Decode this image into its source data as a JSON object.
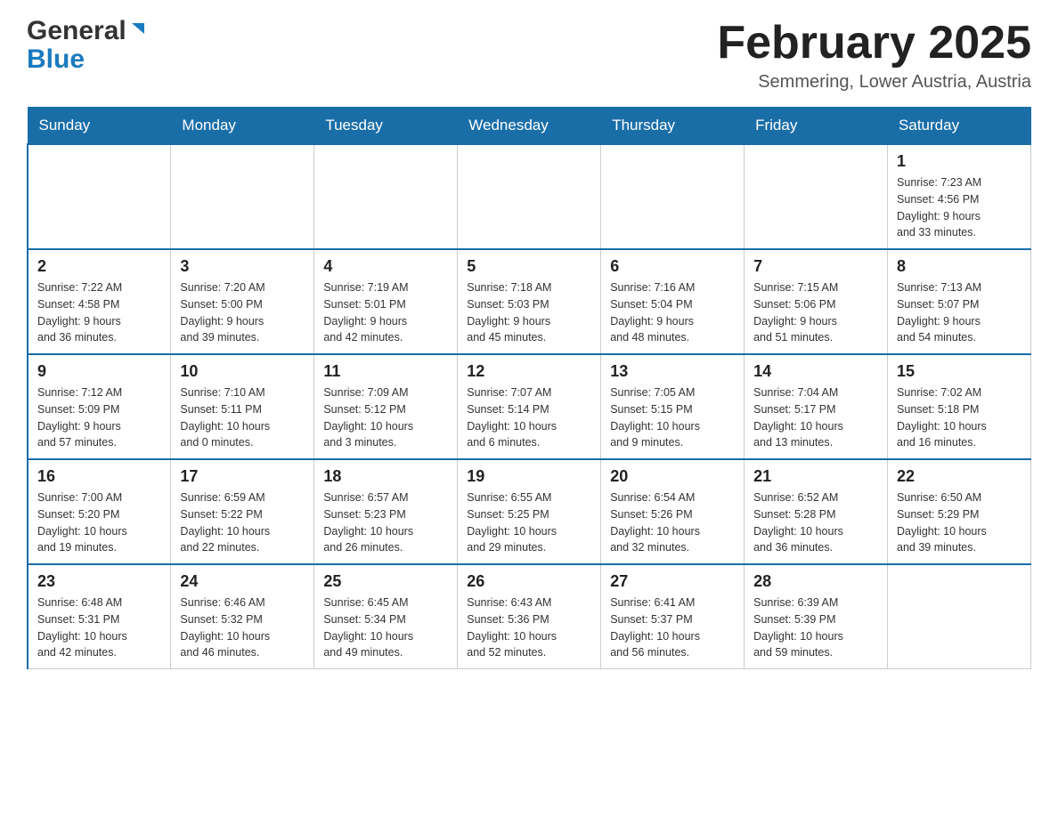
{
  "header": {
    "logo_general": "General",
    "logo_blue": "Blue",
    "month_title": "February 2025",
    "location": "Semmering, Lower Austria, Austria"
  },
  "days_of_week": [
    "Sunday",
    "Monday",
    "Tuesday",
    "Wednesday",
    "Thursday",
    "Friday",
    "Saturday"
  ],
  "weeks": [
    {
      "days": [
        {
          "number": "",
          "info": ""
        },
        {
          "number": "",
          "info": ""
        },
        {
          "number": "",
          "info": ""
        },
        {
          "number": "",
          "info": ""
        },
        {
          "number": "",
          "info": ""
        },
        {
          "number": "",
          "info": ""
        },
        {
          "number": "1",
          "info": "Sunrise: 7:23 AM\nSunset: 4:56 PM\nDaylight: 9 hours\nand 33 minutes."
        }
      ]
    },
    {
      "days": [
        {
          "number": "2",
          "info": "Sunrise: 7:22 AM\nSunset: 4:58 PM\nDaylight: 9 hours\nand 36 minutes."
        },
        {
          "number": "3",
          "info": "Sunrise: 7:20 AM\nSunset: 5:00 PM\nDaylight: 9 hours\nand 39 minutes."
        },
        {
          "number": "4",
          "info": "Sunrise: 7:19 AM\nSunset: 5:01 PM\nDaylight: 9 hours\nand 42 minutes."
        },
        {
          "number": "5",
          "info": "Sunrise: 7:18 AM\nSunset: 5:03 PM\nDaylight: 9 hours\nand 45 minutes."
        },
        {
          "number": "6",
          "info": "Sunrise: 7:16 AM\nSunset: 5:04 PM\nDaylight: 9 hours\nand 48 minutes."
        },
        {
          "number": "7",
          "info": "Sunrise: 7:15 AM\nSunset: 5:06 PM\nDaylight: 9 hours\nand 51 minutes."
        },
        {
          "number": "8",
          "info": "Sunrise: 7:13 AM\nSunset: 5:07 PM\nDaylight: 9 hours\nand 54 minutes."
        }
      ]
    },
    {
      "days": [
        {
          "number": "9",
          "info": "Sunrise: 7:12 AM\nSunset: 5:09 PM\nDaylight: 9 hours\nand 57 minutes."
        },
        {
          "number": "10",
          "info": "Sunrise: 7:10 AM\nSunset: 5:11 PM\nDaylight: 10 hours\nand 0 minutes."
        },
        {
          "number": "11",
          "info": "Sunrise: 7:09 AM\nSunset: 5:12 PM\nDaylight: 10 hours\nand 3 minutes."
        },
        {
          "number": "12",
          "info": "Sunrise: 7:07 AM\nSunset: 5:14 PM\nDaylight: 10 hours\nand 6 minutes."
        },
        {
          "number": "13",
          "info": "Sunrise: 7:05 AM\nSunset: 5:15 PM\nDaylight: 10 hours\nand 9 minutes."
        },
        {
          "number": "14",
          "info": "Sunrise: 7:04 AM\nSunset: 5:17 PM\nDaylight: 10 hours\nand 13 minutes."
        },
        {
          "number": "15",
          "info": "Sunrise: 7:02 AM\nSunset: 5:18 PM\nDaylight: 10 hours\nand 16 minutes."
        }
      ]
    },
    {
      "days": [
        {
          "number": "16",
          "info": "Sunrise: 7:00 AM\nSunset: 5:20 PM\nDaylight: 10 hours\nand 19 minutes."
        },
        {
          "number": "17",
          "info": "Sunrise: 6:59 AM\nSunset: 5:22 PM\nDaylight: 10 hours\nand 22 minutes."
        },
        {
          "number": "18",
          "info": "Sunrise: 6:57 AM\nSunset: 5:23 PM\nDaylight: 10 hours\nand 26 minutes."
        },
        {
          "number": "19",
          "info": "Sunrise: 6:55 AM\nSunset: 5:25 PM\nDaylight: 10 hours\nand 29 minutes."
        },
        {
          "number": "20",
          "info": "Sunrise: 6:54 AM\nSunset: 5:26 PM\nDaylight: 10 hours\nand 32 minutes."
        },
        {
          "number": "21",
          "info": "Sunrise: 6:52 AM\nSunset: 5:28 PM\nDaylight: 10 hours\nand 36 minutes."
        },
        {
          "number": "22",
          "info": "Sunrise: 6:50 AM\nSunset: 5:29 PM\nDaylight: 10 hours\nand 39 minutes."
        }
      ]
    },
    {
      "days": [
        {
          "number": "23",
          "info": "Sunrise: 6:48 AM\nSunset: 5:31 PM\nDaylight: 10 hours\nand 42 minutes."
        },
        {
          "number": "24",
          "info": "Sunrise: 6:46 AM\nSunset: 5:32 PM\nDaylight: 10 hours\nand 46 minutes."
        },
        {
          "number": "25",
          "info": "Sunrise: 6:45 AM\nSunset: 5:34 PM\nDaylight: 10 hours\nand 49 minutes."
        },
        {
          "number": "26",
          "info": "Sunrise: 6:43 AM\nSunset: 5:36 PM\nDaylight: 10 hours\nand 52 minutes."
        },
        {
          "number": "27",
          "info": "Sunrise: 6:41 AM\nSunset: 5:37 PM\nDaylight: 10 hours\nand 56 minutes."
        },
        {
          "number": "28",
          "info": "Sunrise: 6:39 AM\nSunset: 5:39 PM\nDaylight: 10 hours\nand 59 minutes."
        },
        {
          "number": "",
          "info": ""
        }
      ]
    }
  ]
}
